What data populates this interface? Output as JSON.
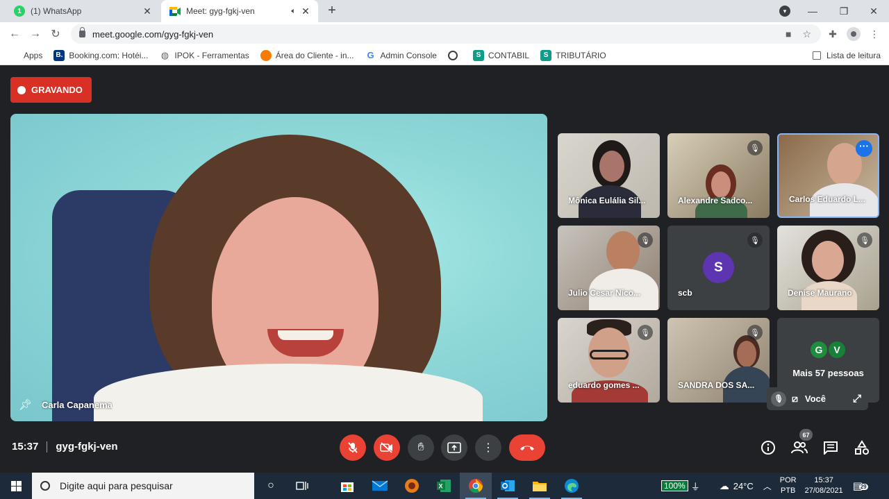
{
  "browser": {
    "tabs": [
      {
        "title": "(1) WhatsApp",
        "badge": "1",
        "close": "✕"
      },
      {
        "title": "Meet: gyg-fgkj-ven",
        "close": "✕"
      }
    ],
    "new_tab": "+",
    "address": "meet.google.com/gyg-fgkj-ven",
    "bookmarks": [
      {
        "label": "Apps",
        "icon": "apps-grid-icon"
      },
      {
        "label": "Booking.com: Hotéi...",
        "icon": "booking-icon",
        "glyph": "B."
      },
      {
        "label": "IPOK - Ferramentas",
        "icon": "globe-icon"
      },
      {
        "label": "Área do Cliente - in...",
        "icon": "orange-circle-icon"
      },
      {
        "label": "Admin Console",
        "icon": "google-g-icon",
        "glyph": "G"
      },
      {
        "label": "",
        "icon": "spiral-icon"
      },
      {
        "label": "CONTABIL",
        "icon": "s-badge-icon",
        "glyph": "S"
      },
      {
        "label": "TRIBUTÁRIO",
        "icon": "s-badge-icon",
        "glyph": "S"
      }
    ],
    "reading_list": "Lista de leitura"
  },
  "meet": {
    "recording_label": "GRAVANDO",
    "main_speaker": "Carla Capanema",
    "participants": [
      {
        "name": "Mônica Eulália Sil...",
        "muted": false
      },
      {
        "name": "Alexandre Sadco...",
        "muted": true
      },
      {
        "name": "Carlos Eduardo L...",
        "muted": false,
        "active": true
      },
      {
        "name": "Julio Cesar Nico...",
        "muted": true
      },
      {
        "name": "scb",
        "muted": true,
        "initial": "S"
      },
      {
        "name": "Denise Maurano",
        "muted": true
      },
      {
        "name": "eduardo gomes ...",
        "muted": true
      },
      {
        "name": "SANDRA DOS SA...",
        "muted": true
      }
    ],
    "more": {
      "initials": [
        "G",
        "V"
      ],
      "label": "Mais 57 pessoas"
    },
    "self_label": "Você",
    "time": "15:37",
    "meeting_code": "gyg-fgkj-ven",
    "people_count": "67"
  },
  "taskbar": {
    "search_placeholder": "Digite aqui para pesquisar",
    "battery": "100%",
    "temperature": "24°C",
    "lang_1": "POR",
    "lang_2": "PTB",
    "clock_time": "15:37",
    "clock_date": "27/08/2021",
    "notifications": "29"
  },
  "colors": {
    "recording": "#d93025",
    "meet_bg": "#202124",
    "end_call": "#ea4335",
    "active_border": "#8ab4f8",
    "taskbar": "#1c2a3a"
  }
}
